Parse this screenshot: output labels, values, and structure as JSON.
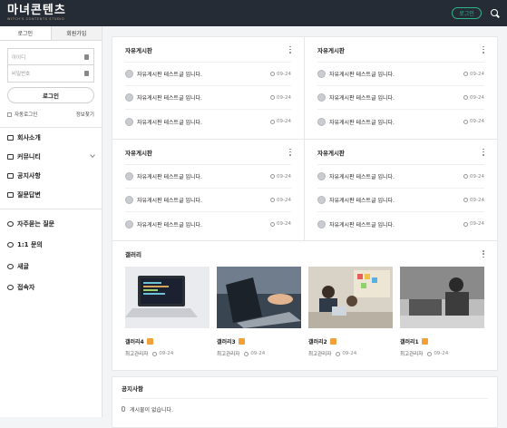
{
  "header": {
    "brand_title": "마녀콘텐츠",
    "brand_sub": "WITCH'S CONTENTS STUDIO",
    "login_label": "로그인"
  },
  "sidebar": {
    "tabs": [
      "로그인",
      "회원가입"
    ],
    "id_placeholder": "아이디",
    "pw_placeholder": "비밀번호",
    "login_button": "로그인",
    "auto_login": "자동로그인",
    "find_info": "정보찾기",
    "menu": [
      "회사소개",
      "커뮤니티",
      "공지사항",
      "질문답변"
    ],
    "menu2": [
      "자주묻는 질문",
      "1:1 문의",
      "새글",
      "접속자"
    ]
  },
  "boards": [
    {
      "title": "자유게시판",
      "posts": [
        {
          "text": "자유게시판 테스트글 입니다.",
          "date": "09-24"
        },
        {
          "text": "자유게시판 테스트글 입니다.",
          "date": "09-24"
        },
        {
          "text": "자유게시판 테스트글 입니다.",
          "date": "09-24"
        }
      ]
    },
    {
      "title": "자유게시판",
      "posts": [
        {
          "text": "자유게시판 테스트글 입니다.",
          "date": "09-24"
        },
        {
          "text": "자유게시판 테스트글 입니다.",
          "date": "09-24"
        },
        {
          "text": "자유게시판 테스트글 입니다.",
          "date": "09-24"
        }
      ]
    },
    {
      "title": "자유게시판",
      "posts": [
        {
          "text": "자유게시판 테스트글 입니다.",
          "date": "09-24"
        },
        {
          "text": "자유게시판 테스트글 입니다.",
          "date": "09-24"
        },
        {
          "text": "자유게시판 테스트글 입니다.",
          "date": "09-24"
        }
      ]
    },
    {
      "title": "자유게시판",
      "posts": [
        {
          "text": "자유게시판 테스트글 입니다.",
          "date": "09-24"
        },
        {
          "text": "자유게시판 테스트글 입니다.",
          "date": "09-24"
        },
        {
          "text": "자유게시판 테스트글 입니다.",
          "date": "09-24"
        }
      ]
    }
  ],
  "gallery": {
    "title": "갤러리",
    "items": [
      {
        "title": "갤러리4",
        "author": "최고관리자",
        "date": "09-24"
      },
      {
        "title": "갤러리3",
        "author": "최고관리자",
        "date": "09-24"
      },
      {
        "title": "갤러리2",
        "author": "최고관리자",
        "date": "09-24"
      },
      {
        "title": "갤러리1",
        "author": "최고관리자",
        "date": "09-24"
      }
    ]
  },
  "notice": {
    "title": "공지사항",
    "empty": "게시물이 없습니다."
  },
  "colors": {
    "topbar": "#262c36",
    "accent": "#2fb58a",
    "photo_badge": "#f2a03a"
  }
}
